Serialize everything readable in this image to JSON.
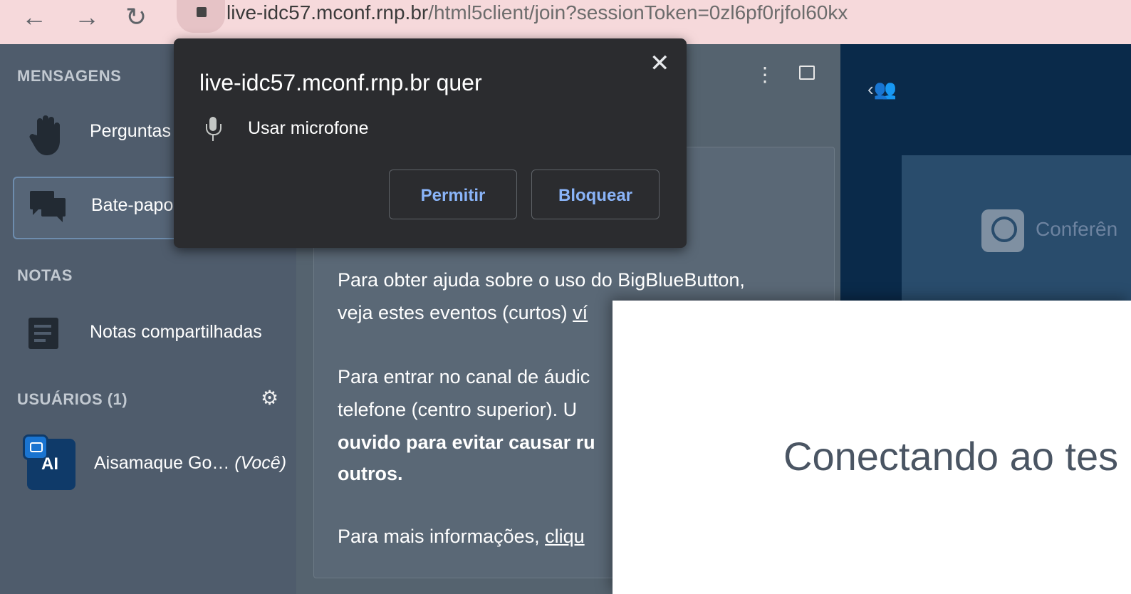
{
  "browser": {
    "url_host": "live-idc57.mconf.rnp.br",
    "url_path": "/html5client/join?sessionToken=0zl6pf0rjfol60kx"
  },
  "sidebar": {
    "messages_title": "MENSAGENS",
    "items": [
      {
        "label": "Perguntas"
      },
      {
        "label": "Bate-papo"
      }
    ],
    "notes_title": "NOTAS",
    "notes_item": "Notas compartilhadas",
    "users_title": "USUÁRIOS (1)",
    "user": {
      "initials": "AI",
      "name": "Aisamaque Go…",
      "suffix": "(Você)"
    }
  },
  "chat": {
    "exclamation": "!",
    "p1_line1": "Para obter ajuda sobre o uso do BigBlueButton,",
    "p1_line2_plain": "veja estes eventos (curtos) ",
    "p1_line2_link": "ví",
    "p2_line1": "Para entrar no canal de áudic",
    "p2_line2": "telefone (centro superior). U",
    "p2_line3": "ouvido para evitar causar ru",
    "p2_line4": "outros.",
    "p3_plain": "Para mais informações, ",
    "p3_link": "cliqu"
  },
  "presentation": {
    "conference_text": "Conferên"
  },
  "modal": {
    "text": "Conectando ao tes"
  },
  "permission_popup": {
    "title": "live-idc57.mconf.rnp.br quer",
    "request": "Usar microfone",
    "allow": "Permitir",
    "block": "Bloquear",
    "close": "✕"
  },
  "colors": {
    "browser_bar": "#f6d9db",
    "sidebar": "#4f5c6c",
    "popup_bg": "#2b2c2f",
    "button_text": "#8ab4f8"
  }
}
